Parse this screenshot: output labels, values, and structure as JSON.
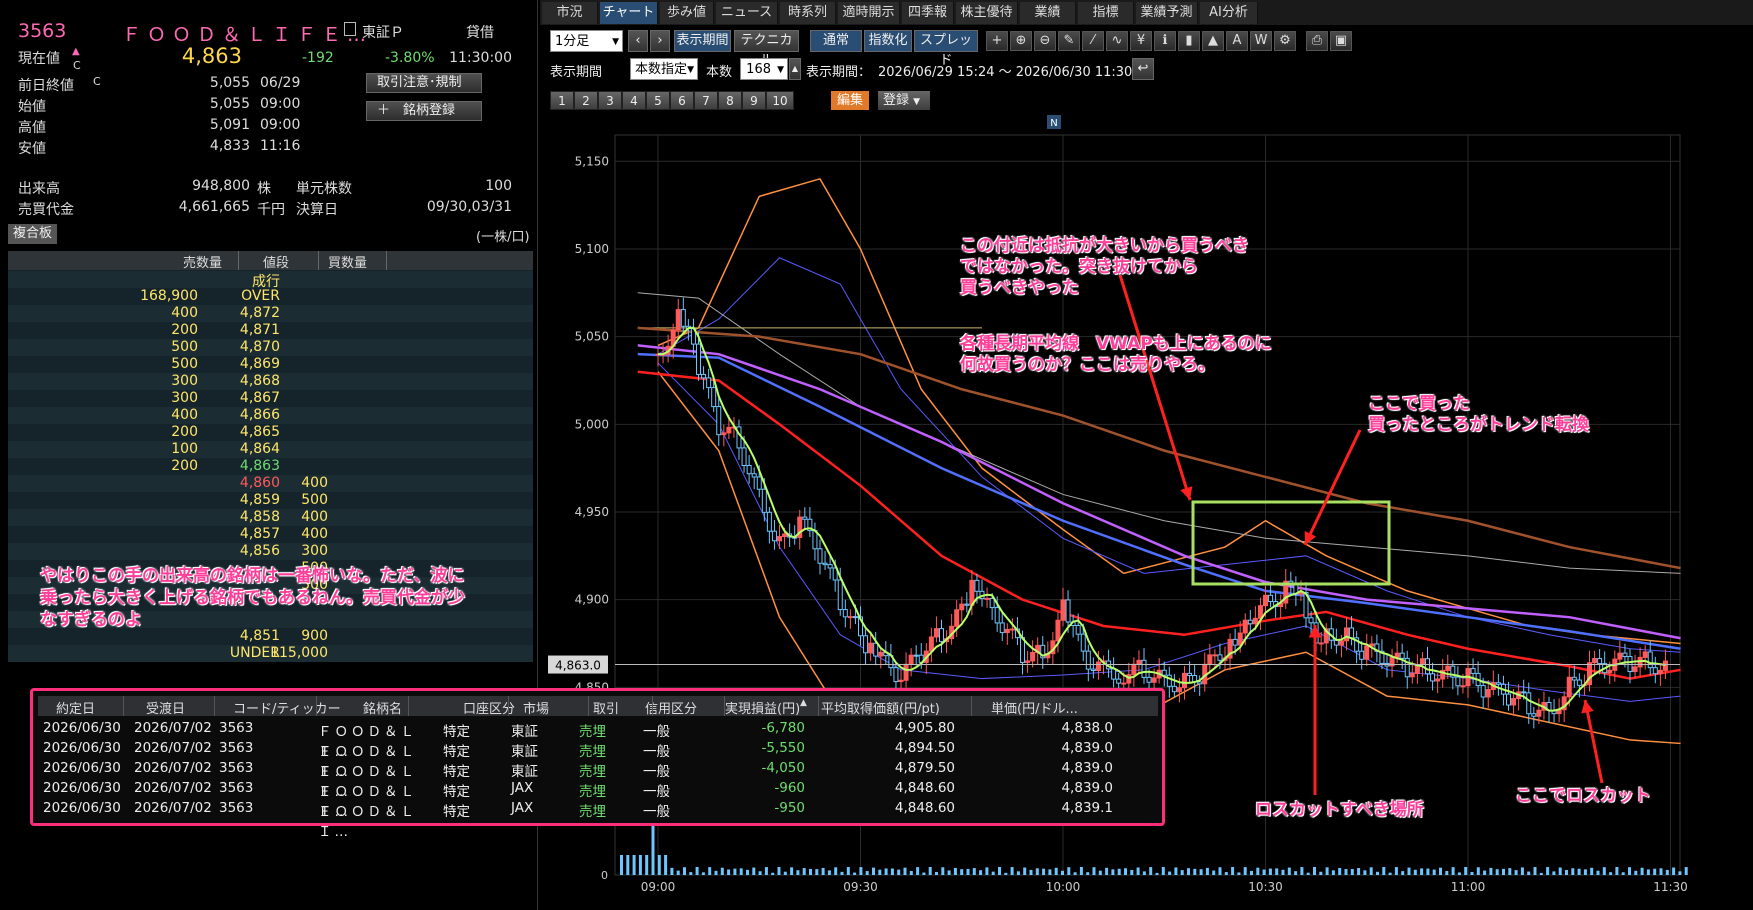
{
  "quote": {
    "code": "3563",
    "name": "ＦＯＯＤ＆ＬＩＦＥ…",
    "exchange": "東証Ｐ",
    "lending": "貸借",
    "current_label": "現在値",
    "current_price": "4,863",
    "change": "-192",
    "change_pct": "-3.80%",
    "time": "11:30:00",
    "rows": [
      {
        "label": "前日終値",
        "value": "5,055",
        "time": "06/29"
      },
      {
        "label": "始値",
        "value": "5,055",
        "time": "09:00"
      },
      {
        "label": "高値",
        "value": "5,091",
        "time": "09:00"
      },
      {
        "label": "安値",
        "value": "4,833",
        "time": "11:16"
      }
    ],
    "c_mark": "C",
    "volume_label": "出来高",
    "volume": "948,800",
    "volume_unit": "株",
    "unit_shares_label": "単元株数",
    "unit_shares": "100",
    "turnover_label": "売買代金",
    "turnover": "4,661,665",
    "turnover_unit": "千円",
    "settle_label": "決算日",
    "settle": "09/30,03/31",
    "btn_caution": "取引注意･規制",
    "btn_register": "＋　銘柄登録",
    "board_tag": "複合板",
    "unit_note": "(一株/口)"
  },
  "book": {
    "headers": [
      "売数量",
      "値段",
      "買数量"
    ],
    "rows": [
      {
        "sell": "",
        "price": "成行",
        "buy": "",
        "pc": "#ffe66a"
      },
      {
        "sell": "168,900",
        "price": "OVER",
        "buy": "",
        "pc": "#ffe66a"
      },
      {
        "sell": "400",
        "price": "4,872",
        "buy": "",
        "pc": "#ffe66a"
      },
      {
        "sell": "200",
        "price": "4,871",
        "buy": "",
        "pc": "#ffe66a"
      },
      {
        "sell": "500",
        "price": "4,870",
        "buy": "",
        "pc": "#ffe66a"
      },
      {
        "sell": "500",
        "price": "4,869",
        "buy": "",
        "pc": "#ffe66a"
      },
      {
        "sell": "300",
        "price": "4,868",
        "buy": "",
        "pc": "#ffe66a"
      },
      {
        "sell": "300",
        "price": "4,867",
        "buy": "",
        "pc": "#ffe66a"
      },
      {
        "sell": "400",
        "price": "4,866",
        "buy": "",
        "pc": "#ffe66a"
      },
      {
        "sell": "200",
        "price": "4,865",
        "buy": "",
        "pc": "#ffe66a"
      },
      {
        "sell": "100",
        "price": "4,864",
        "buy": "",
        "pc": "#ffe66a"
      },
      {
        "sell": "200",
        "price": "4,863",
        "buy": "",
        "pc": "#6fdc6f"
      },
      {
        "sell": "",
        "price": "4,860",
        "buy": "400",
        "pc": "#ff5a5a"
      },
      {
        "sell": "",
        "price": "4,859",
        "buy": "500",
        "pc": "#ffe66a"
      },
      {
        "sell": "",
        "price": "4,858",
        "buy": "400",
        "pc": "#ffe66a"
      },
      {
        "sell": "",
        "price": "4,857",
        "buy": "400",
        "pc": "#ffe66a"
      },
      {
        "sell": "",
        "price": "4,856",
        "buy": "300",
        "pc": "#ffe66a"
      },
      {
        "sell": "",
        "price": "",
        "buy": "500",
        "pc": "#ffe66a"
      },
      {
        "sell": "",
        "price": "",
        "buy": "500",
        "pc": "#ffe66a"
      },
      {
        "sell": "",
        "price": "",
        "buy": "",
        "pc": "#ffe66a"
      },
      {
        "sell": "",
        "price": "",
        "buy": "",
        "pc": "#ffe66a"
      },
      {
        "sell": "",
        "price": "4,851",
        "buy": "900",
        "pc": "#ffe66a"
      },
      {
        "sell": "",
        "price": "UNDER",
        "buy": "115,000",
        "pc": "#ffe66a"
      }
    ]
  },
  "note_left": "やはりこの手の出来高の銘柄は一番怖いな。ただ、波に乗ったら大きく上げる銘柄でもあるねん。売買代金が少なすぎるのよ",
  "tabs": [
    "市況",
    "チャート",
    "歩み値",
    "ニュース",
    "時系列",
    "適時開示",
    "四季報",
    "株主優待",
    "業績",
    "指標",
    "業績予測",
    "AI分析"
  ],
  "toolbar": {
    "interval": "1分足",
    "display_period": "表示期間",
    "technical": "テクニカル",
    "normal": "通常",
    "index": "指数化",
    "spread": "スプレッド",
    "period_label": "表示期間",
    "count_mode": "本数指定",
    "count_label": "本数",
    "count_value": "168",
    "range_label": "表示期間：",
    "range_value": "2026/06/29 15:24 ～ 2026/06/30 11:30",
    "numbers": [
      "1",
      "2",
      "3",
      "4",
      "5",
      "6",
      "7",
      "8",
      "9",
      "10"
    ],
    "edit": "編集",
    "register": "登録"
  },
  "chart_data": {
    "type": "candlestick",
    "y_ticks": [
      "5,150",
      "5,100",
      "5,050",
      "5,000",
      "4,950",
      "4,900",
      "4,850"
    ],
    "x_ticks": [
      "09:00",
      "09:30",
      "10:00",
      "10:30",
      "11:00",
      "11:30"
    ],
    "current_label": "4,863.0",
    "ylim": [
      4800,
      5165
    ],
    "news_marker": "N",
    "zero_label": "0"
  },
  "annotations": {
    "a1": "この付近は抵抗が大きいから買うべきではなかった。突き抜けてから買うべきやった",
    "a2": "各種長期平均線　VWAPも上にあるのに何故買うのか？ここは売りやろ。",
    "a3": "ここで買った\n買ったところがトレンド転換",
    "a4": "ロスカットすべき場所",
    "a5": "ここでロスカット"
  },
  "trades": {
    "headers": [
      "約定日",
      "受渡日",
      "コード/ティッカー",
      "銘柄名",
      "口座区分",
      "市場",
      "取引",
      "信用区分",
      "実現損益(円)",
      "平均取得価額(円/pt)",
      "単価(円/ドル..."
    ],
    "rows": [
      [
        "2026/06/30",
        "2026/07/02",
        "3563",
        "ＦＯＯＤ＆ＬＩ…",
        "特定",
        "東証",
        "売埋",
        "一般",
        "-6,780",
        "4,905.80",
        "4,838.0"
      ],
      [
        "2026/06/30",
        "2026/07/02",
        "3563",
        "ＦＯＯＤ＆ＬＩ…",
        "特定",
        "東証",
        "売埋",
        "一般",
        "-5,550",
        "4,894.50",
        "4,839.0"
      ],
      [
        "2026/06/30",
        "2026/07/02",
        "3563",
        "ＦＯＯＤ＆ＬＩ…",
        "特定",
        "東証",
        "売埋",
        "一般",
        "-4,050",
        "4,879.50",
        "4,839.0"
      ],
      [
        "2026/06/30",
        "2026/07/02",
        "3563",
        "ＦＯＯＤ＆ＬＩ…",
        "特定",
        "JAX",
        "売埋",
        "一般",
        "-960",
        "4,848.60",
        "4,839.0"
      ],
      [
        "2026/06/30",
        "2026/07/02",
        "3563",
        "ＦＯＯＤ＆ＬＩ…",
        "特定",
        "JAX",
        "売埋",
        "一般",
        "-950",
        "4,848.60",
        "4,839.1"
      ]
    ]
  }
}
